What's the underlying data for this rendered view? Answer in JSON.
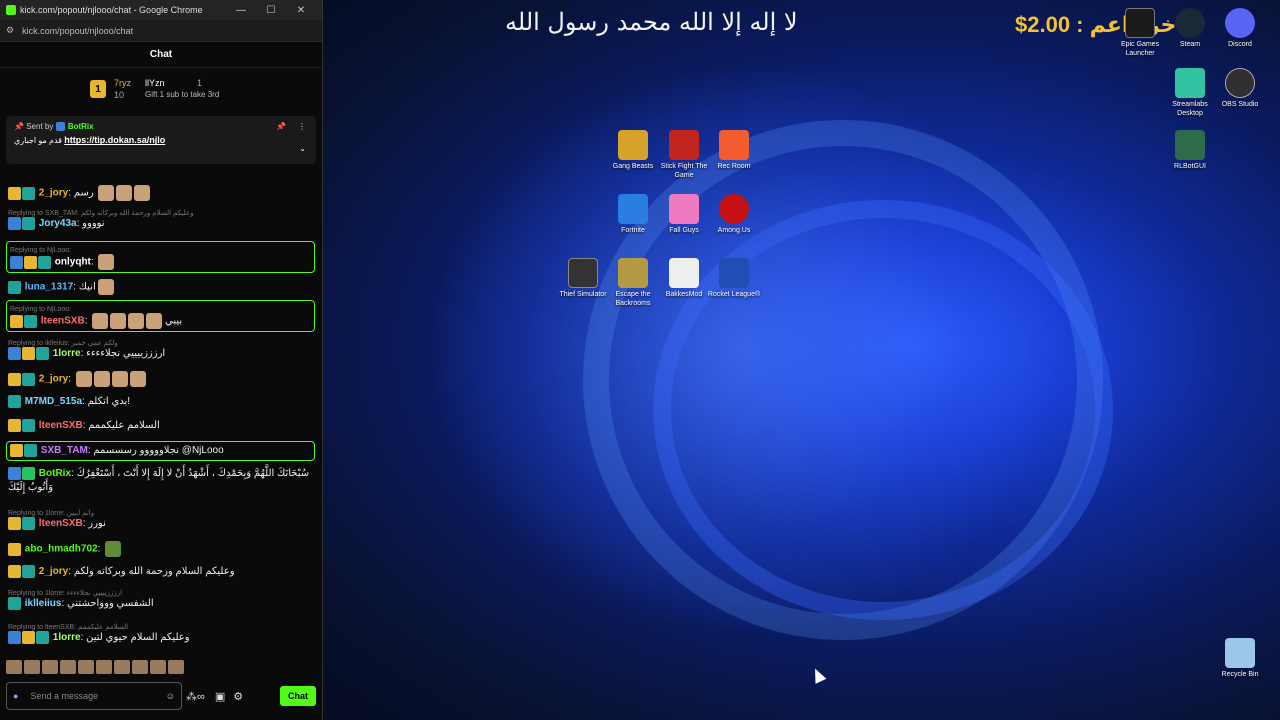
{
  "browser": {
    "title": "kick.com/popout/njlooo/chat - Google Chrome",
    "url": "kick.com/popout/njlooo/chat",
    "min": "—",
    "max": "☐",
    "close": "✕"
  },
  "chat": {
    "header": "Chat",
    "leaderboard": {
      "rank": "1",
      "name1": "7ryz",
      "count1": "10",
      "name2": "llYzn",
      "count2": "1",
      "gift_text": "Gift 1 sub to take 3rd"
    },
    "pinned": {
      "sent_by": "Sent by",
      "user": "BotRix",
      "text": "قدم مو اجباري",
      "link": "https://tip.dokan.sa/njlo"
    },
    "messages": [
      {
        "user": "2_jory",
        "color": "#e8b632",
        "text": "رسم",
        "reply": ""
      },
      {
        "user": "Jory43a",
        "color": "#7ad7ff",
        "text": "نوووو",
        "reply": "Replying to SXB_TAM: وعليكم السلام ورحمة الله وبركاته ولكم"
      },
      {
        "user": "onlyqht",
        "color": "#ffffff",
        "text": "",
        "reply": "Replying to NjLooo:"
      },
      {
        "user": "luna_1317",
        "color": "#5ab7ff",
        "text": "انيك",
        "reply": ""
      },
      {
        "user": "lteenSXB",
        "color": "#ff6b6b",
        "text": "بيبي",
        "reply": "Replying to NjLooo:"
      },
      {
        "user": "1lorre",
        "color": "#a3ff6b",
        "text": "ارزززييييي نجلاءءءء",
        "reply": "Replying to iklleiius: ولكم عمي خمير"
      },
      {
        "user": "2_jory",
        "color": "#e8b632",
        "text": "",
        "reply": ""
      },
      {
        "user": "M7MD_515a",
        "color": "#7ad7ff",
        "text": "بدي اتكلم!",
        "reply": ""
      },
      {
        "user": "lteenSXB",
        "color": "#ff6b6b",
        "text": "السلامم عليكممم",
        "reply": ""
      },
      {
        "user": "SXB_TAM",
        "color": "#c77dff",
        "text": "نجلاووووو رسسسمم @NjLooo",
        "reply": ""
      },
      {
        "user": "BotRix",
        "color": "#53fc18",
        "text": "سُبْحَانَكَ اللَّهُمَّ وَبِحَمْدِكَ ، أَشْهَدُ أَنْ لا إِلَهَ إِلا أَنْتَ ، أَسْتَغْفِرُكَ وَأَتُوبُ إِلَيْكَ",
        "reply": ""
      },
      {
        "user": "lteenSXB",
        "color": "#ff6b6b",
        "text": "نورر",
        "reply": "Replying to 1lorre: واتم ابيين"
      },
      {
        "user": "abo_hmadh702",
        "color": "#53fc18",
        "text": "",
        "reply": ""
      },
      {
        "user": "2_jory",
        "color": "#e8b632",
        "text": "وعليكم السلام ورحمة الله وبركاته ولكم",
        "reply": ""
      },
      {
        "user": "iklleiius",
        "color": "#7ad7ff",
        "text": "الشفسي ووواحشتني",
        "reply": "Replying to 1lorre: ارزززييييي نجلاءءءء"
      },
      {
        "user": "1lorre",
        "color": "#a3ff6b",
        "text": "وعليكم السلام حيوي لتين",
        "reply": "Replying to lteenSXB: السلامم عليكممم"
      }
    ],
    "input_placeholder": "Send a message",
    "chat_button": "Chat"
  },
  "desktop": {
    "arabic_text": "لا إله إلا الله محمد رسول الله",
    "money_text": "$2.00 : اخر داعم",
    "icons": [
      {
        "label": "Epic Games Launcher",
        "color": "#1b1b1b"
      },
      {
        "label": "Steam",
        "color": "#1b2838"
      },
      {
        "label": "Discord",
        "color": "#5865f2"
      },
      {
        "label": "Streamlabs Desktop",
        "color": "#31c3a2"
      },
      {
        "label": "OBS Studio",
        "color": "#302e31"
      },
      {
        "label": "RLBotGUI",
        "color": "#2e6b4a"
      },
      {
        "label": "Gang Beasts",
        "color": "#d7a22a"
      },
      {
        "label": "Stick Fight The Game",
        "color": "#c2241e"
      },
      {
        "label": "Rec Room",
        "color": "#f25c2f"
      },
      {
        "label": "Fortnite",
        "color": "#2a7de1"
      },
      {
        "label": "Fall Guys",
        "color": "#f07ac0"
      },
      {
        "label": "Among Us",
        "color": "#c51111"
      },
      {
        "label": "Thief Simulator",
        "color": "#333333"
      },
      {
        "label": "Escape the Backrooms",
        "color": "#b59a44"
      },
      {
        "label": "BakkesMod",
        "color": "#eeeeee"
      },
      {
        "label": "Rocket League®",
        "color": "#1f4fb5"
      },
      {
        "label": "Recycle Bin",
        "color": "#9bc7e8"
      }
    ]
  }
}
